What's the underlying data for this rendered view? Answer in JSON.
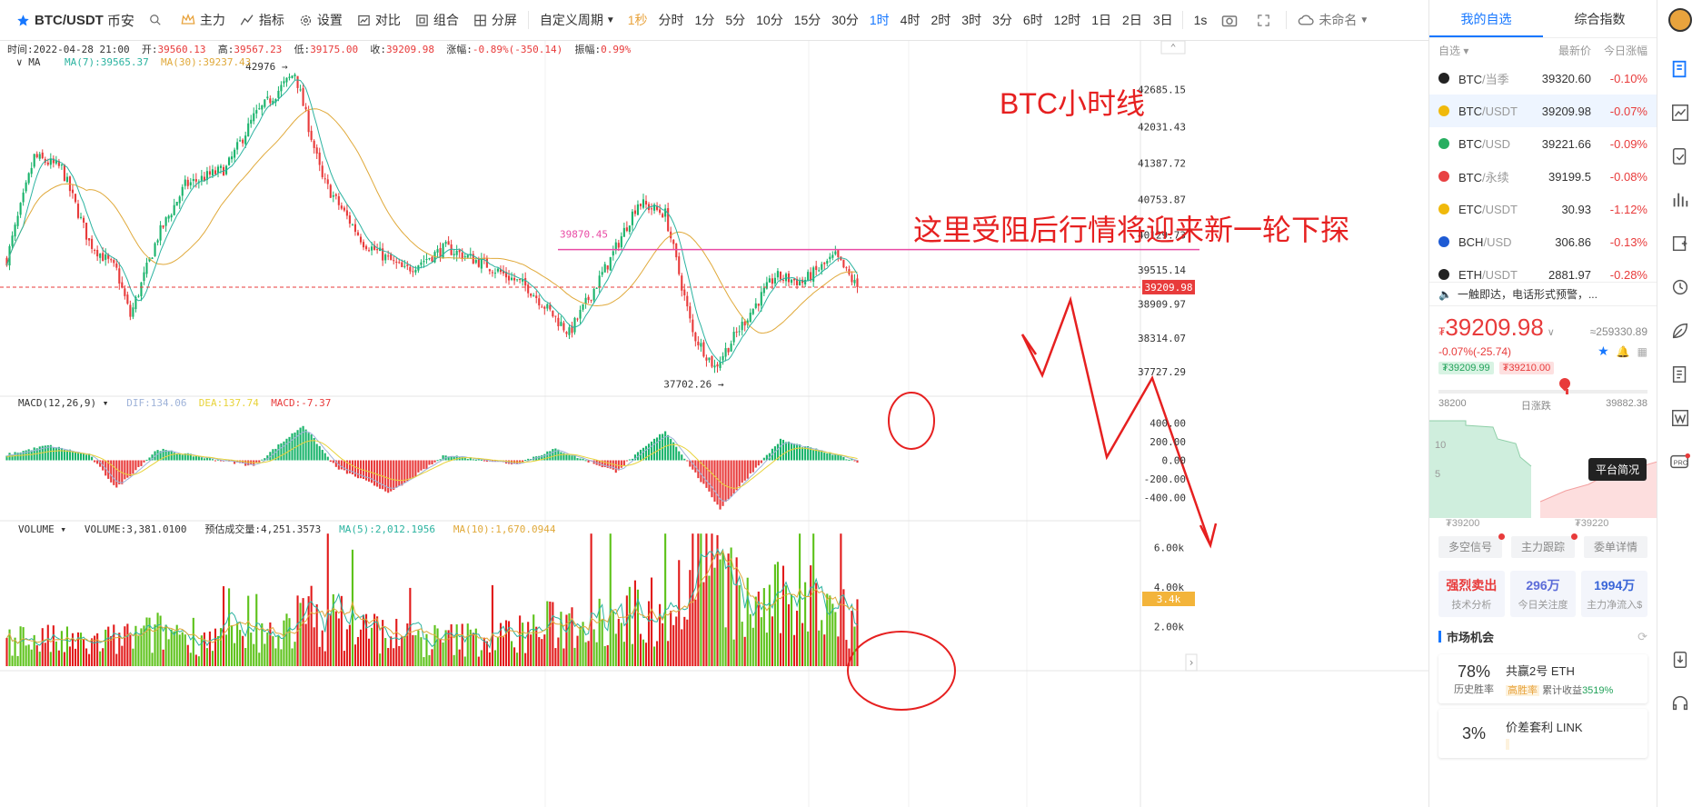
{
  "toolbar": {
    "symbol": "BTC/USDT",
    "exchange": "币安",
    "buttons": {
      "main": "主力",
      "indicator": "指标",
      "settings": "设置",
      "compare": "对比",
      "combine": "组合",
      "split": "分屏",
      "custom": "自定义周期"
    },
    "periods": [
      "1秒",
      "分时",
      "1分",
      "5分",
      "10分",
      "15分",
      "30分",
      "1时",
      "4时",
      "2时",
      "3时",
      "3分",
      "6时",
      "12时",
      "1日",
      "2日",
      "3日"
    ],
    "active_period": "1时",
    "interval": "1s",
    "template_name": "未命名"
  },
  "ohlc": {
    "time_label": "时间:",
    "time": "2022-04-28 21:00",
    "open_label": "开:",
    "open": "39560.13",
    "high_label": "高:",
    "high": "39567.23",
    "low_label": "低:",
    "low": "39175.00",
    "close_label": "收:",
    "close": "39209.98",
    "chg_label": "涨幅:",
    "chg": "-0.89%(-350.14)",
    "amp_label": "振幅:",
    "amp": "0.99%"
  },
  "ma_legend": {
    "name": "MA",
    "ma7": "MA(7):39565.37",
    "ma30": "MA(30):39237.43"
  },
  "macd_legend": {
    "name": "MACD(12,26,9)",
    "dif": "DIF:134.06",
    "dea": "DEA:137.74",
    "macd": "MACD:-7.37"
  },
  "vol_legend": {
    "name": "VOLUME",
    "vol": "VOLUME:3,381.0100",
    "est": "预估成交量:4,251.3573",
    "ma5": "MA(5):2,012.1956",
    "ma10": "MA(10):1,670.0944"
  },
  "price_axis": [
    "42685.15",
    "42031.43",
    "41387.72",
    "40753.87",
    "40129.73",
    "39515.14",
    "38909.97",
    "38314.07",
    "37727.29"
  ],
  "current_price_tag": "39209.98",
  "macd_axis": [
    "400.00",
    "200.00",
    "0.00",
    "-200.00",
    "-400.00"
  ],
  "vol_axis": [
    "6.00k",
    "4.00k",
    "2.00k"
  ],
  "vol_current_tag": "3.4k",
  "annotations": {
    "title": "BTC小时线",
    "note": "这里受阻后行情将迎来新一轮下探",
    "high_label": "42976",
    "low_label": "37702.26",
    "resistance_label": "39870.45"
  },
  "chart_data": {
    "type": "candlestick",
    "title": "BTC小时线",
    "interval": "1时",
    "high": 42976,
    "low": 37702.26,
    "resistance": 39870.45,
    "last": 39209.98,
    "ylim": [
      37500,
      42900
    ],
    "trend_points": [
      [
        0,
        39700
      ],
      [
        10,
        41500
      ],
      [
        20,
        41300
      ],
      [
        30,
        40000
      ],
      [
        40,
        39500
      ],
      [
        45,
        38700
      ],
      [
        55,
        40100
      ],
      [
        65,
        41000
      ],
      [
        80,
        41300
      ],
      [
        90,
        42200
      ],
      [
        105,
        42980
      ],
      [
        115,
        41100
      ],
      [
        130,
        40000
      ],
      [
        145,
        39500
      ],
      [
        160,
        39900
      ],
      [
        175,
        39600
      ],
      [
        190,
        39200
      ],
      [
        205,
        38400
      ],
      [
        220,
        39700
      ],
      [
        230,
        40700
      ],
      [
        240,
        40500
      ],
      [
        250,
        38400
      ],
      [
        258,
        37800
      ],
      [
        270,
        38700
      ],
      [
        280,
        39400
      ],
      [
        290,
        39300
      ],
      [
        302,
        39750
      ],
      [
        310,
        39200
      ]
    ],
    "macd_trend": [
      [
        0,
        60
      ],
      [
        15,
        160
      ],
      [
        30,
        60
      ],
      [
        40,
        -300
      ],
      [
        55,
        120
      ],
      [
        70,
        40
      ],
      [
        90,
        -60
      ],
      [
        108,
        380
      ],
      [
        120,
        -80
      ],
      [
        140,
        -350
      ],
      [
        160,
        60
      ],
      [
        185,
        -40
      ],
      [
        200,
        120
      ],
      [
        222,
        -120
      ],
      [
        240,
        320
      ],
      [
        260,
        -520
      ],
      [
        282,
        220
      ],
      [
        310,
        -10
      ]
    ],
    "vol_trend": [
      [
        0,
        1800
      ],
      [
        30,
        1400
      ],
      [
        60,
        2200
      ],
      [
        90,
        1500
      ],
      [
        110,
        3200
      ],
      [
        130,
        2400
      ],
      [
        150,
        1600
      ],
      [
        180,
        1800
      ],
      [
        200,
        2600
      ],
      [
        240,
        3600
      ],
      [
        255,
        6200
      ],
      [
        270,
        3600
      ],
      [
        290,
        4200
      ],
      [
        310,
        3400
      ]
    ]
  },
  "right": {
    "tabs": [
      "我的自选",
      "综合指数"
    ],
    "head": {
      "col1": "自选",
      "col2": "最新价",
      "col3": "今日涨幅"
    },
    "watch": [
      {
        "name": "BTC",
        "quote": "/当季",
        "price": "39320.60",
        "chg": "-0.10%",
        "color": "#222222"
      },
      {
        "name": "BTC",
        "quote": "/USDT",
        "price": "39209.98",
        "chg": "-0.07%",
        "color": "#f0b90b"
      },
      {
        "name": "BTC",
        "quote": "/USD",
        "price": "39221.66",
        "chg": "-0.09%",
        "color": "#27ae60"
      },
      {
        "name": "BTC",
        "quote": "/永续",
        "price": "39199.5",
        "chg": "-0.08%",
        "color": "#e84142"
      },
      {
        "name": "ETC",
        "quote": "/USDT",
        "price": "30.93",
        "chg": "-1.12%",
        "color": "#f0b90b"
      },
      {
        "name": "BCH",
        "quote": "/USD",
        "price": "306.86",
        "chg": "-0.13%",
        "color": "#1e5bd4"
      },
      {
        "name": "ETH",
        "quote": "/USDT",
        "price": "2881.97",
        "chg": "-0.28%",
        "color": "#222222"
      }
    ],
    "notice": "一触即达，电话形式预警，...",
    "price": "39209.98",
    "usd": "≈259330.89",
    "change": "-0.07%(-25.74)",
    "bid": "₮39209.99",
    "ask": "₮39210.00",
    "range_low": "38200",
    "range_high": "39882.38",
    "range_label": "日涨跌",
    "tooltip": "平台简况",
    "depth_left": "₮39200",
    "depth_right": "₮39220",
    "depth_y1": "10",
    "depth_y2": "5",
    "btns": [
      "多空信号",
      "主力跟踪",
      "委单详情"
    ],
    "stats": [
      {
        "value": "强烈卖出",
        "label": "技术分析"
      },
      {
        "value": "296万",
        "label": "今日关注度"
      },
      {
        "value": "1994万",
        "label": "主力净流入$"
      }
    ],
    "market": "市场机会",
    "opp": [
      {
        "pct": "78%",
        "pct_label": "历史胜率",
        "title": "共赢2号 ETH",
        "tag": "高胜率",
        "gain_label": "累计收益",
        "gain": "3519%"
      },
      {
        "pct": "3%",
        "pct_label": "",
        "title": "价差套利 LINK",
        "tag": "",
        "gain_label": "",
        "gain": ""
      }
    ]
  }
}
